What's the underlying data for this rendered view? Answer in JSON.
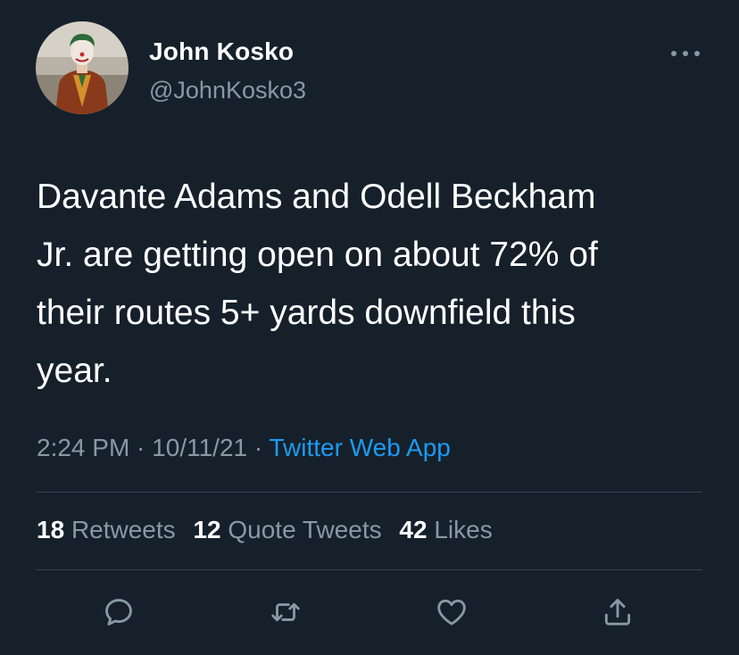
{
  "author": {
    "display_name": "John Kosko",
    "handle": "@JohnKosko3"
  },
  "tweet": {
    "text": "Davante Adams and Odell Beckham\nJr. are getting open on about 72% of\ntheir routes 5+ yards downfield this\nyear."
  },
  "meta": {
    "time": "2:24 PM",
    "separator1": " · ",
    "date": "10/11/21",
    "separator2": " · ",
    "source": "Twitter Web App"
  },
  "stats": {
    "retweets_count": "18",
    "retweets_label": "Retweets",
    "quote_count": "12",
    "quote_label": "Quote Tweets",
    "likes_count": "42",
    "likes_label": "Likes"
  },
  "actions": [
    {
      "name": "reply",
      "icon": "reply-icon"
    },
    {
      "name": "retweet",
      "icon": "retweet-icon"
    },
    {
      "name": "like",
      "icon": "heart-icon"
    },
    {
      "name": "share",
      "icon": "share-icon"
    }
  ],
  "colors": {
    "background": "#15202b",
    "secondary_text": "#8899a6",
    "link": "#1d9bf0",
    "divider": "#38444d"
  }
}
